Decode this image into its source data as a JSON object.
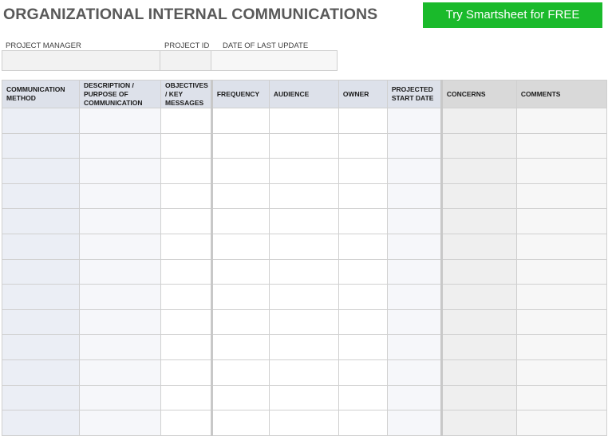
{
  "header": {
    "title": "ORGANIZATIONAL INTERNAL COMMUNICATIONS",
    "cta_label": "Try Smartsheet for FREE",
    "cta_color": "#1ABA2B"
  },
  "project_info": {
    "manager_label": "PROJECT MANAGER",
    "manager_value": "",
    "id_label": "PROJECT ID",
    "id_value": "",
    "date_label": "DATE OF LAST UPDATE",
    "date_value": ""
  },
  "table": {
    "columns": [
      {
        "label": "COMMUNICATION METHOD"
      },
      {
        "label": "DESCRIPTION / PURPOSE OF COMMUNICATION"
      },
      {
        "label": "OBJECTIVES / KEY MESSAGES"
      },
      {
        "label": "FREQUENCY"
      },
      {
        "label": "AUDIENCE"
      },
      {
        "label": "OWNER"
      },
      {
        "label": "PROJECTED START DATE"
      },
      {
        "label": "CONCERNS"
      },
      {
        "label": "COMMENTS"
      }
    ],
    "row_count": 13,
    "header_color": "#DDE1EA",
    "header_alt_color": "#D9D9D9"
  }
}
